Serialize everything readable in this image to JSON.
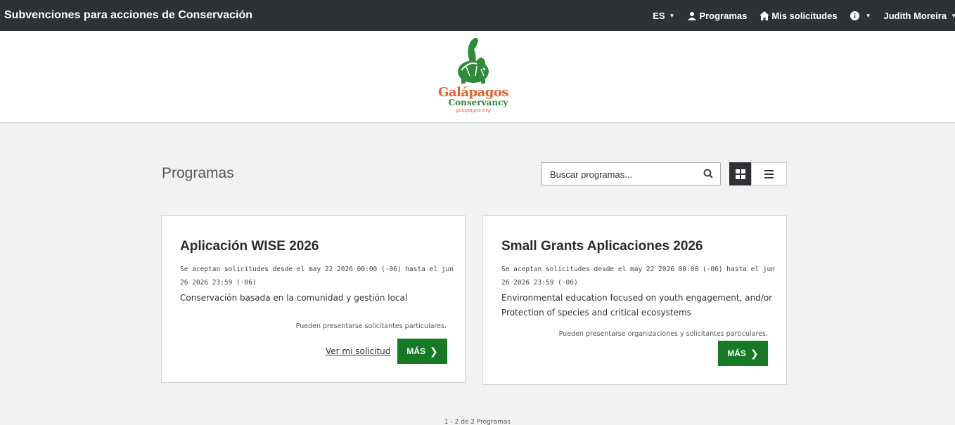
{
  "header": {
    "title": "Subvenciones para acciones de Conservación",
    "language": "ES",
    "nav_programs": "Programas",
    "nav_my_requests": "Mis solicitudes",
    "user_name": "Judith Moreira"
  },
  "logo": {
    "line1": "Galápagos",
    "line2": "Conservancy",
    "line3": "galapagos.org"
  },
  "main": {
    "title": "Programas",
    "search": {
      "placeholder": "Buscar programas..."
    }
  },
  "programs": [
    {
      "title": "Aplicación WISE 2026",
      "dates": "Se aceptan solicitudes desde el may 22 2026 00:00 (-06) hasta el jun 26 2026 23:59 (-06)",
      "description": "Conservación basada en la comunidad y gestión local",
      "eligibility": "Pueden presentarse solicitantes particulares.",
      "link_label": "Ver mi solicitud",
      "button_label": "MÁS"
    },
    {
      "title": "Small Grants Aplicaciones 2026",
      "dates": "Se aceptan solicitudes desde el may 22 2026 00:00 (-06) hasta el jun 26 2026 23:59 (-06)",
      "description": "Environmental education focused on youth engagement, and/or Protection of species and critical ecosystems",
      "eligibility": "Pueden presentarse organizaciones y solicitantes particulares.",
      "button_label": "MÁS"
    }
  ],
  "pagination": "1 - 2 de 2 Programas",
  "colors": {
    "topbar": "#2e3237",
    "button_green": "#157a21",
    "logo_orange": "#e8612c",
    "logo_green": "#2e8b3a"
  }
}
